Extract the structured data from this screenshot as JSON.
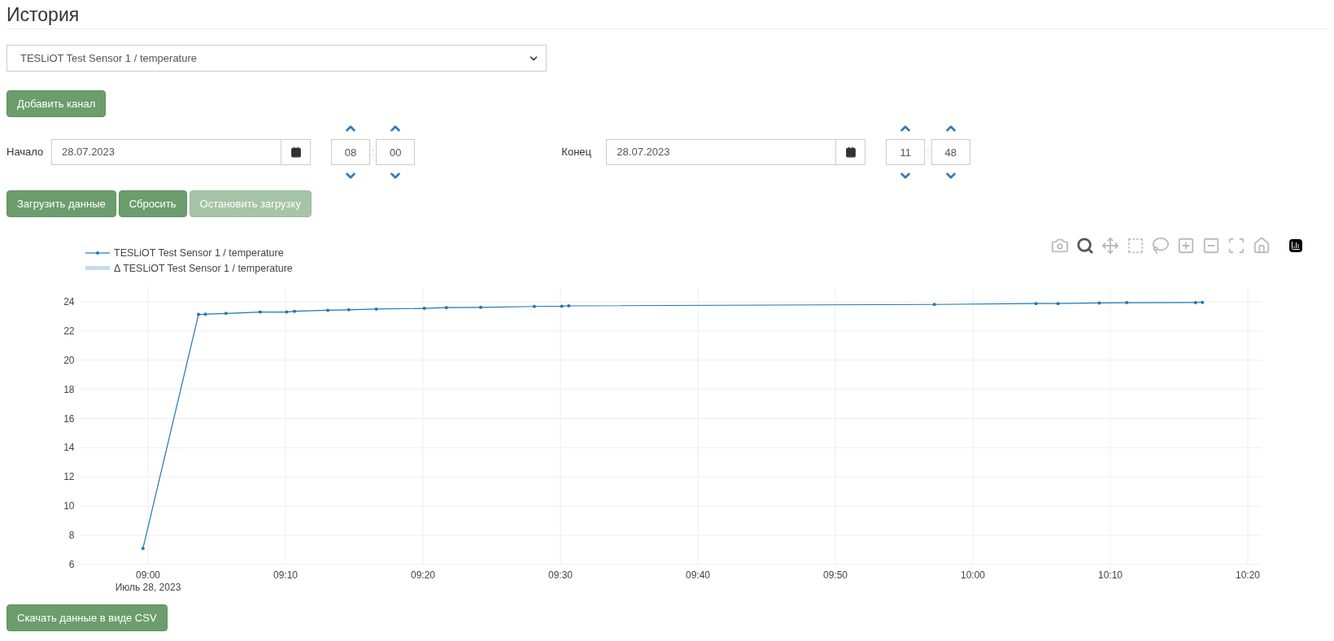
{
  "title": "История",
  "channel_select": {
    "value": "TESLiOT Test Sensor 1 / temperature"
  },
  "add_button": {
    "label": "Добавить канал"
  },
  "start": {
    "label": "Начало",
    "date": "28.07.2023",
    "hour": "08",
    "minute": "00",
    "separator": ":"
  },
  "end": {
    "label": "Конец",
    "date": "28.07.2023",
    "hour": "11",
    "minute": "48",
    "separator": ":"
  },
  "actions": [
    {
      "label": "Загрузить данные",
      "disabled": false
    },
    {
      "label": "Сбросить",
      "disabled": false
    },
    {
      "label": "Остановить загрузку",
      "disabled": true
    }
  ],
  "modebar": [
    {
      "selected": false
    },
    {
      "selected": true
    },
    {
      "selected": false
    },
    {
      "selected": false
    },
    {
      "selected": false
    },
    {
      "selected": false
    },
    {
      "selected": false
    },
    {
      "selected": false
    },
    {
      "selected": false
    }
  ],
  "chart": {
    "band_legend": {
      "name": "Δ TESLiOT Test Sensor 1 / temperature",
      "color": "#c6dbef"
    },
    "chart_data": {
      "type": "line",
      "grid": true,
      "x": [
        539.63,
        543.67,
        544.17,
        545.67,
        548.16,
        550.09,
        550.65,
        553.08,
        554.6,
        556.6,
        560.1,
        561.7,
        564.2,
        568.1,
        570.1,
        570.6,
        597.2,
        604.6,
        606.2,
        609.2,
        611.2,
        616.2,
        616.7
      ],
      "series": [
        {
          "name": "TESLiOT Test Sensor 1 / temperature",
          "color": "#1f77b4",
          "values": [
            7.1,
            23.13,
            23.15,
            23.2,
            23.3,
            23.3,
            23.35,
            23.42,
            23.45,
            23.5,
            23.55,
            23.6,
            23.62,
            23.68,
            23.7,
            23.72,
            23.82,
            23.88,
            23.88,
            23.92,
            23.94,
            23.95,
            23.96
          ]
        }
      ],
      "xlim": [
        535,
        621
      ],
      "ylim": [
        6,
        25
      ],
      "xticks": [
        {
          "value": 540,
          "label": "09:00"
        },
        {
          "value": 550,
          "label": "09:10"
        },
        {
          "value": 560,
          "label": "09:20"
        },
        {
          "value": 570,
          "label": "09:30"
        },
        {
          "value": 580,
          "label": "09:40"
        },
        {
          "value": 590,
          "label": "09:50"
        },
        {
          "value": 600,
          "label": "10:00"
        },
        {
          "value": 610,
          "label": "10:10"
        },
        {
          "value": 620,
          "label": "10:20"
        }
      ],
      "yticks": [
        6,
        8,
        10,
        12,
        14,
        16,
        18,
        20,
        22,
        24
      ],
      "annotations": [
        "Июль 28, 2023"
      ]
    }
  },
  "csv_button": {
    "label": "Скачать данные в виде CSV"
  }
}
